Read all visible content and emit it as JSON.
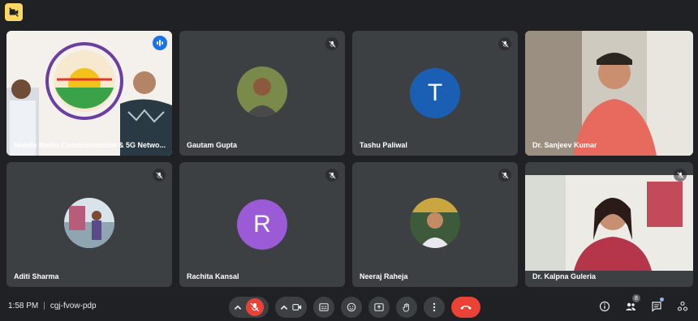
{
  "meeting": {
    "time": "1:58 PM",
    "code": "cgj-fvow-pdp",
    "people_count": "8"
  },
  "tiles": [
    {
      "name": "Mobile Radio Communication & 5G Netwo...",
      "type": "video",
      "speaking": true
    },
    {
      "name": "Gautam Gupta",
      "type": "photo"
    },
    {
      "name": "Tashu Paliwal",
      "type": "letter",
      "letter": "T",
      "color": "#1a5fb4"
    },
    {
      "name": "Dr. Sanjeev Kumar",
      "type": "video"
    },
    {
      "name": "Aditi Sharma",
      "type": "photo"
    },
    {
      "name": "Rachita Kansal",
      "type": "letter",
      "letter": "R",
      "color": "#9c5bd6"
    },
    {
      "name": "Neeraj Raheja",
      "type": "photo"
    },
    {
      "name": "Dr. Kalpna Guleria",
      "type": "video"
    }
  ],
  "colors": {
    "background": "#202124",
    "tile": "#3c4043",
    "accent": "#8ab4f8",
    "danger": "#ea4335"
  },
  "icons": {
    "mic_off": "mic-off-icon",
    "camera": "camera-icon",
    "captions": "captions-icon",
    "emoji": "emoji-icon",
    "present": "present-icon",
    "hand": "raise-hand-icon",
    "more": "more-vert-icon",
    "end_call": "end-call-icon",
    "info": "info-icon",
    "people": "people-icon",
    "chat": "chat-icon",
    "activities": "activities-icon"
  }
}
